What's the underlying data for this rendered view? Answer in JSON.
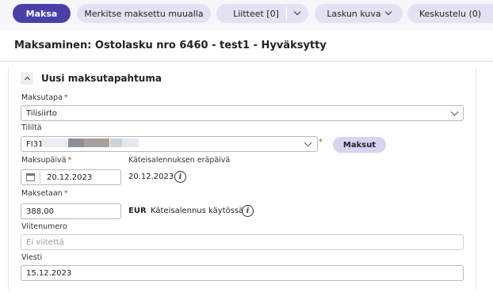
{
  "toolbar": {
    "pay": "Maksa",
    "mark_paid": "Merkitse maksettu muualla",
    "attachments": "Liitteet [0]",
    "invoice_image": "Laskun kuva",
    "discussion": "Keskustelu (0)"
  },
  "page_title": "Maksaminen: Ostolasku nro 6460 - test1 - Hyväksytty",
  "section": {
    "title": "Uusi maksutapahtuma",
    "expanded": true
  },
  "form": {
    "payment_method": {
      "label": "Maksutapa",
      "required": "*",
      "value": "Tilisiirto"
    },
    "account": {
      "label": "Tililtä",
      "value_prefix": "FI31",
      "required": "*",
      "payments_button": "Maksut"
    },
    "payment_date": {
      "label": "Maksupäivä",
      "required": "*",
      "value": "20.12.2023"
    },
    "cash_discount_due": {
      "label": "Käteisalennuksen eräpäivä",
      "value": "20.12.2023"
    },
    "amount": {
      "label": "Maksetaan",
      "required": "*",
      "value": "388,00",
      "currency": "EUR",
      "discount_note": "Käteisalennus käytössä"
    },
    "reference": {
      "label": "Viitenumero",
      "placeholder": "Ei viitettä"
    },
    "message": {
      "label": "Viesti",
      "value": "15.12.2023"
    }
  },
  "icons": {
    "info": "i",
    "collapse": "chevron-up-icon",
    "calendar": "calendar-icon"
  },
  "colors": {
    "primary": "#4a3fa8",
    "secondary_button": "#e5e1f4",
    "required": "#c0392b"
  }
}
